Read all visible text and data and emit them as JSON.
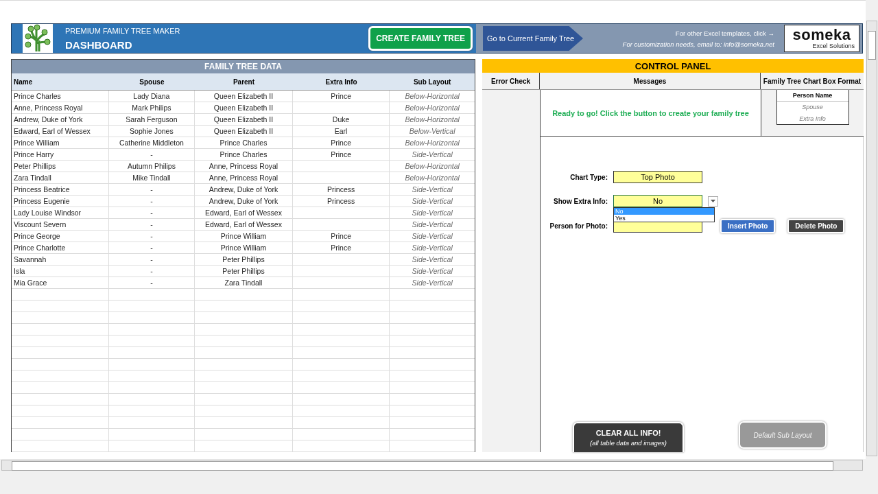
{
  "header": {
    "subtitle": "PREMIUM FAMILY TREE MAKER",
    "title": "DASHBOARD",
    "create_button": "CREATE FAMILY TREE",
    "goto_button": "Go to Current Family Tree",
    "templates_link": "For other Excel templates, click →",
    "email_note": "For customization needs, email to: info@someka.net",
    "logo": {
      "name": "someka",
      "tagline": "Excel Solutions"
    }
  },
  "family_table": {
    "title": "FAMILY TREE DATA",
    "columns": [
      "Name",
      "Spouse",
      "Parent",
      "Extra Info",
      "Sub Layout"
    ],
    "rows": [
      {
        "name": "Prince Charles",
        "spouse": "Lady Diana",
        "parent": "Queen Elizabeth II",
        "extra_info": "Prince",
        "sub_layout": "Below-Horizontal"
      },
      {
        "name": "Anne, Princess Royal",
        "spouse": "Mark Philips",
        "parent": "Queen Elizabeth II",
        "sub_layout": "Below-Horizontal"
      },
      {
        "name": "Andrew, Duke of York",
        "spouse": "Sarah Ferguson",
        "parent": "Queen Elizabeth II",
        "extra_info": "Duke",
        "sub_layout": "Below-Horizontal"
      },
      {
        "name": "Edward, Earl of Wessex",
        "spouse": "Sophie Jones",
        "parent": "Queen Elizabeth II",
        "extra_info": "Earl",
        "sub_layout": "Below-Vertical"
      },
      {
        "name": "Prince William",
        "spouse": "Catherine Middleton",
        "parent": "Prince Charles",
        "extra_info": "Prince",
        "sub_layout": "Below-Horizontal"
      },
      {
        "name": "Prince Harry",
        "spouse": "-",
        "parent": "Prince Charles",
        "extra_info": "Prince",
        "sub_layout": "Side-Vertical"
      },
      {
        "name": "Peter Phillips",
        "spouse": "Autumn Philips",
        "parent": "Anne, Princess Royal",
        "sub_layout": "Below-Horizontal"
      },
      {
        "name": "Zara Tindall",
        "spouse": "Mike Tindall",
        "parent": "Anne, Princess Royal",
        "sub_layout": "Below-Horizontal"
      },
      {
        "name": "Princess Beatrice",
        "spouse": "-",
        "parent": "Andrew, Duke of York",
        "extra_info": "Princess",
        "sub_layout": "Side-Vertical"
      },
      {
        "name": "Princess Eugenie",
        "spouse": "-",
        "parent": "Andrew, Duke of York",
        "extra_info": "Princess",
        "sub_layout": "Side-Vertical"
      },
      {
        "name": "Lady Louise Windsor",
        "spouse": "-",
        "parent": "Edward, Earl of Wessex",
        "sub_layout": "Side-Vertical"
      },
      {
        "name": "Viscount Severn",
        "spouse": "-",
        "parent": "Edward, Earl of Wessex",
        "sub_layout": "Side-Vertical"
      },
      {
        "name": "Prince George",
        "spouse": "-",
        "parent": "Prince William",
        "extra_info": "Prince",
        "sub_layout": "Side-Vertical"
      },
      {
        "name": "Prince Charlotte",
        "spouse": "-",
        "parent": "Prince William",
        "extra_info": "Prince",
        "sub_layout": "Side-Vertical"
      },
      {
        "name": "Savannah",
        "spouse": "-",
        "parent": "Peter Phillips",
        "sub_layout": "Side-Vertical"
      },
      {
        "name": "Isla",
        "spouse": "-",
        "parent": "Peter Phillips",
        "sub_layout": "Side-Vertical"
      },
      {
        "name": "Mia Grace",
        "spouse": "-",
        "parent": "Zara Tindall",
        "sub_layout": "Side-Vertical"
      }
    ]
  },
  "control_panel": {
    "title": "CONTROL PANEL",
    "columns": [
      "Error Check",
      "Messages",
      "Family Tree Chart Box Format"
    ],
    "message": "Ready to go! Click the button to create your family tree",
    "box_format": [
      "Person Name",
      "Spouse",
      "Extra Info"
    ],
    "fields": [
      {
        "label": "Chart Type:",
        "value": "Top Photo"
      },
      {
        "label": "Show Extra Info:",
        "value": "No",
        "options": [
          {
            "label": "No",
            "selected": true
          },
          {
            "label": "Yes",
            "selected": false
          }
        ]
      },
      {
        "label": "Person for Photo:"
      }
    ],
    "photo_buttons": [
      {
        "label": "Insert Photo",
        "kind": "primary"
      },
      {
        "label": "Delete Photo",
        "kind": "dark"
      }
    ],
    "clear_button": {
      "title": "CLEAR ALL INFO!",
      "subtitle": "(all table data and images)"
    },
    "layout_button": "Default Sub Layout"
  }
}
